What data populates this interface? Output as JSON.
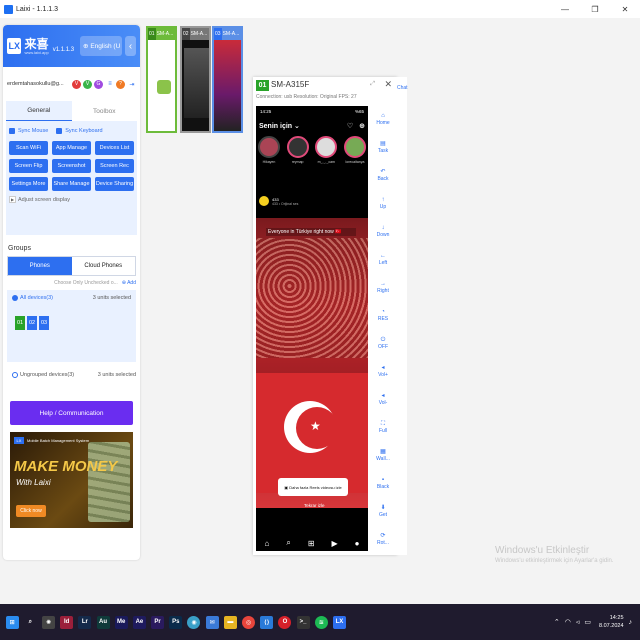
{
  "window": {
    "title": "Laixi - 1.1.1.3"
  },
  "brand": {
    "name": "来喜",
    "url": "www.laixi.app",
    "version": "v1.1.1.3",
    "language": "English (U"
  },
  "user": {
    "name": "erdemtahasokullu@g..."
  },
  "tabs": {
    "general": "General",
    "toolbox": "Toolbox"
  },
  "checkboxes": {
    "sync_mouse": "Sync Mouse",
    "sync_keyboard": "Sync Keyboard"
  },
  "general_buttons": [
    "Scan WiFi",
    "App Manage",
    "Devices List",
    "Screen Flip",
    "Screenshot",
    "Screen Rec",
    "Settings More",
    "Share Manage",
    "Device Sharing"
  ],
  "adjust_screen": "Adjust screen display",
  "groups": {
    "title": "Groups",
    "tab_phones": "Phones",
    "tab_cloud": "Cloud Phones",
    "choose_only": "Choose Only",
    "unchecked": "Unchecked o...",
    "add": "Add",
    "all_devices": "All devices(3)",
    "all_selected": "3 units selected",
    "chips": [
      "01",
      "02",
      "03"
    ],
    "ungrouped": "Ungrouped devices(3)",
    "ungrouped_selected": "3 units selected"
  },
  "help_button": "Help / Communication",
  "ad": {
    "topline": "Mobile Batch Management System",
    "headline": "MAKE MONEY",
    "subline": "With Laixi",
    "cta": "Click now"
  },
  "thumbnails": [
    {
      "num": "01",
      "label": "SM-A..."
    },
    {
      "num": "02",
      "label": "SM-A..."
    },
    {
      "num": "03",
      "label": "SM-A..."
    }
  ],
  "phone": {
    "num": "01",
    "model": "SM-A315F",
    "info": "Connection: usb   Resolution: Original   FPS: 27",
    "status_time": "14:25",
    "status_right": "%65",
    "feed_title": "Senin için",
    "stories": [
      "Hikayen",
      "reymap",
      "m_._._cam",
      "lorecaitanya"
    ],
    "post_user": "433",
    "post_sub": "433 • Orijinal ses",
    "caption": "Everyone in Türkiye right now 🇹🇷",
    "reels_button": "Daha fazla Reels videosu izle",
    "reels_link": "Tekrar izle"
  },
  "side_tools": [
    "Home",
    "Task",
    "Back",
    "Up",
    "Down",
    "Left",
    "Right",
    "RES",
    "OFF",
    "Vol+",
    "Vol-",
    "Full",
    "Wall...",
    "Black",
    "Get",
    "Rot..."
  ],
  "chat_label": "Chat",
  "watermark": {
    "line1": "Windows'u Etkinleştir",
    "line2": "Windows'u etkinleştirmek için Ayarlar'a gidin."
  },
  "taskbar": {
    "apps": [
      "windows-icon",
      "search-icon",
      "chatgpt-icon",
      "indesign-icon",
      "lightroom-icon",
      "audition-icon",
      "media-encoder-icon",
      "after-effects-icon",
      "premiere-icon",
      "photoshop-icon",
      "spotify-alt-icon",
      "mail-icon",
      "folder-icon",
      "chrome-icon",
      "vscode-icon",
      "opera-icon",
      "terminal-icon",
      "spotify-icon",
      "laixi-icon"
    ],
    "time": "14:25",
    "date": "8.07.2024"
  },
  "colors": {
    "accent": "#2d6ff0",
    "help": "#6a2df0",
    "online": "#29a329"
  }
}
